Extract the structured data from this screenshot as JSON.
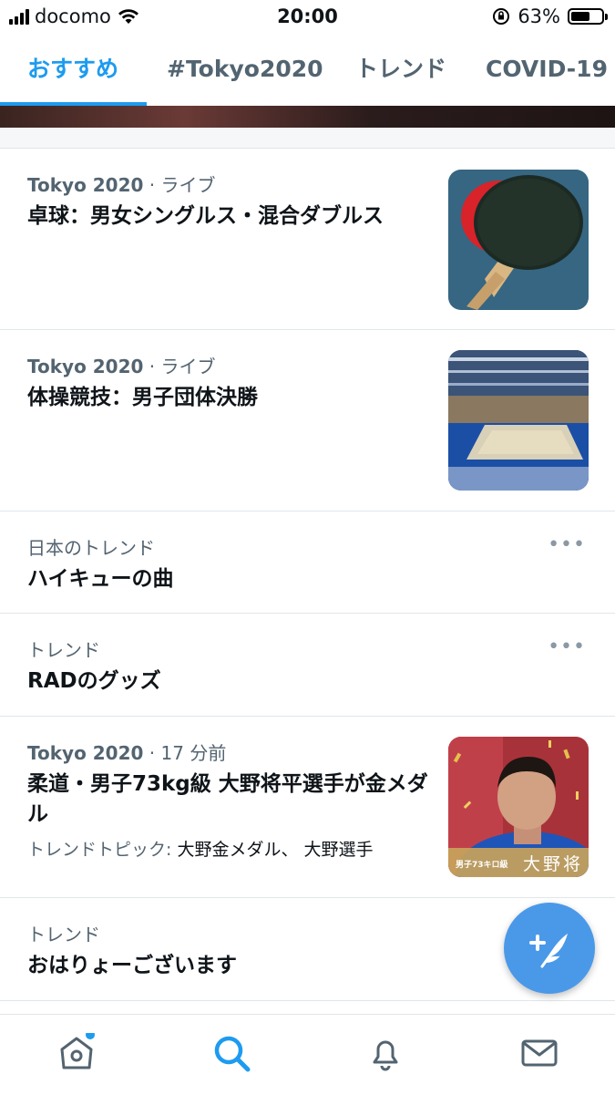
{
  "status_bar": {
    "carrier": "docomo",
    "time": "20:00",
    "battery": "63%",
    "battery_level": 0.63
  },
  "tabs": [
    {
      "label": "おすすめ",
      "active": true
    },
    {
      "label": "#Tokyo2020",
      "active": false
    },
    {
      "label": "トレンド",
      "active": false
    },
    {
      "label": "COVID-19",
      "active": false
    }
  ],
  "feed": [
    {
      "source": "Tokyo 2020",
      "meta": " · ライブ",
      "title": "卓球：男女シングルス・混合ダブルス",
      "thumb": "table-tennis-paddle"
    },
    {
      "source": "Tokyo 2020",
      "meta": " · ライブ",
      "title": "体操競技：男子団体決勝",
      "thumb": "gymnastics-arena"
    },
    {
      "category": "日本のトレンド",
      "title": "ハイキューの曲",
      "more": "•••"
    },
    {
      "category": "トレンド",
      "title": "RADのグッズ",
      "more": "•••"
    },
    {
      "source": "Tokyo 2020",
      "meta": " · 17 分前",
      "title": "柔道・男子73kg級 大野将平選手が金メダル",
      "topics_label": "トレンドトピック: ",
      "topics_value": "大野金メダル、 大野選手",
      "thumb_caption_left": "男子73キロ級",
      "thumb_caption_right": "大野将"
    },
    {
      "category": "トレンド",
      "title": "おはりょーございます"
    }
  ],
  "fab": {
    "icon": "compose-tweet-icon"
  },
  "bottom_nav": [
    {
      "icon": "home-icon",
      "has_notification_dot": true
    },
    {
      "icon": "search-icon",
      "active": true
    },
    {
      "icon": "bell-icon"
    },
    {
      "icon": "mail-icon"
    }
  ],
  "colors": {
    "accent": "#1d9bf0",
    "secondary_text": "#536471",
    "divider": "#e1e6ea"
  }
}
